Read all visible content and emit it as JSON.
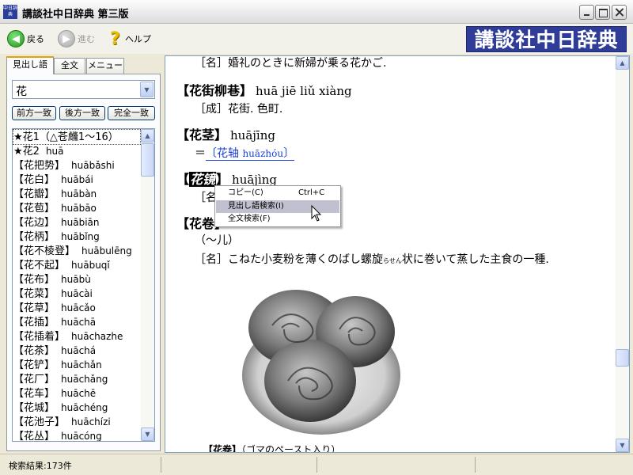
{
  "window": {
    "app_icon_text": "中日辞典",
    "title": "講談社中日辞典 第三版"
  },
  "toolbar": {
    "back_label": "戻る",
    "forward_label": "進む",
    "help_label": "ヘルプ",
    "logo_text": "講談社中日辞典"
  },
  "left": {
    "tabs": [
      "見出し語",
      "全文",
      "メニュー"
    ],
    "search_value": "花",
    "match_buttons": [
      "前方一致",
      "後方一致",
      "完全一致"
    ],
    "results": [
      {
        "hw": "★花1（△苍虪1～16）",
        "py": ""
      },
      {
        "hw": "★花2",
        "py": "huā"
      },
      {
        "hw": "【花把势】",
        "py": "huābǎshi"
      },
      {
        "hw": "【花白】",
        "py": "huābái"
      },
      {
        "hw": "【花瓣】",
        "py": "huābàn"
      },
      {
        "hw": "【花苞】",
        "py": "huābāo"
      },
      {
        "hw": "【花边】",
        "py": "huābiān"
      },
      {
        "hw": "【花柄】",
        "py": "huābǐng"
      },
      {
        "hw": "【花不棱登】",
        "py": "huābulēng"
      },
      {
        "hw": "【花不起】",
        "py": "huābuqǐ"
      },
      {
        "hw": "【花布】",
        "py": "huābù"
      },
      {
        "hw": "【花菜】",
        "py": "huācài"
      },
      {
        "hw": "【花草】",
        "py": "huācǎo"
      },
      {
        "hw": "【花插】",
        "py": "huāchā"
      },
      {
        "hw": "【花插着】",
        "py": "huāchazhe"
      },
      {
        "hw": "【花茶】",
        "py": "huāchá"
      },
      {
        "hw": "【花铲】",
        "py": "huāchǎn"
      },
      {
        "hw": "【花厂】",
        "py": "huāchǎng"
      },
      {
        "hw": "【花车】",
        "py": "huāchē"
      },
      {
        "hw": "【花城】",
        "py": "huāchéng"
      },
      {
        "hw": "【花池子】",
        "py": "huāchízi"
      },
      {
        "hw": "【花丛】",
        "py": "huācóng"
      }
    ]
  },
  "content": {
    "top_line": "［名］婚礼のときに新婦が乗る花かご.",
    "e1": {
      "hw": "【花街柳巷】",
      "py": "huā jiē liǔ xiàng",
      "def": "［成］花街. 色町."
    },
    "e2": {
      "hw": "【花茎】",
      "py": "huājīng",
      "eq": "＝",
      "ref_hw": "〔花轴",
      "ref_py": "huāzhóu",
      "ref_close": "〕"
    },
    "e3": {
      "open": "【",
      "hw": "花镜",
      "close": "】",
      "py": "huājìng",
      "def": "［名］"
    },
    "e4": {
      "hw": "【花卷",
      "close": "】",
      "note": "（～儿）",
      "def": "［名］こねた小麦粉を薄くのばし螺旋",
      "ruby": "らせん",
      "def2": "状に巻いて蒸した主食の一種."
    },
    "caption_hw": "【花卷】",
    "caption_rest": "（ゴマのペースト入り）"
  },
  "context_menu": {
    "items": [
      {
        "label": "コピー(C)",
        "shortcut": "Ctrl+C"
      },
      {
        "label": "見出し語検索(I)",
        "shortcut": ""
      },
      {
        "label": "全文検索(F)",
        "shortcut": ""
      }
    ]
  },
  "status": {
    "text": "検索結果:173件"
  }
}
